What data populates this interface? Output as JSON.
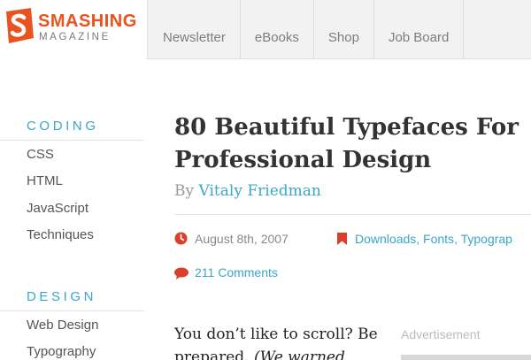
{
  "header": {
    "logo_word1": "SMASHING",
    "logo_word2": "MAGAZINE",
    "nav": [
      "Newsletter",
      "eBooks",
      "Shop",
      "Job Board"
    ]
  },
  "sidebar": {
    "categories": [
      {
        "title": "CODING",
        "links": [
          "CSS",
          "HTML",
          "JavaScript",
          "Techniques"
        ]
      },
      {
        "title": "DESIGN",
        "links": [
          "Web Design",
          "Typography"
        ]
      }
    ]
  },
  "article": {
    "title_line1": "80 Beautiful Typefaces For",
    "title_line2": "Professional Design",
    "by": "By",
    "author": "Vitaly Friedman",
    "date": "August 8th, 2007",
    "tags": [
      "Downloads",
      "Fonts",
      "Typograp"
    ],
    "comments": "211 Comments",
    "body_line1": "You don’t like to scroll? Be",
    "body_line2_plain": "prepared. ",
    "body_line2_em": "(We warned"
  },
  "ad": {
    "label": "Advertisement"
  },
  "colors": {
    "brand": "#e8531f",
    "accent": "#3aa7c8",
    "icon_red": "#d9402b"
  },
  "icons": [
    "smashing-logo-icon",
    "clock-icon",
    "bookmark-icon",
    "comment-icon"
  ]
}
